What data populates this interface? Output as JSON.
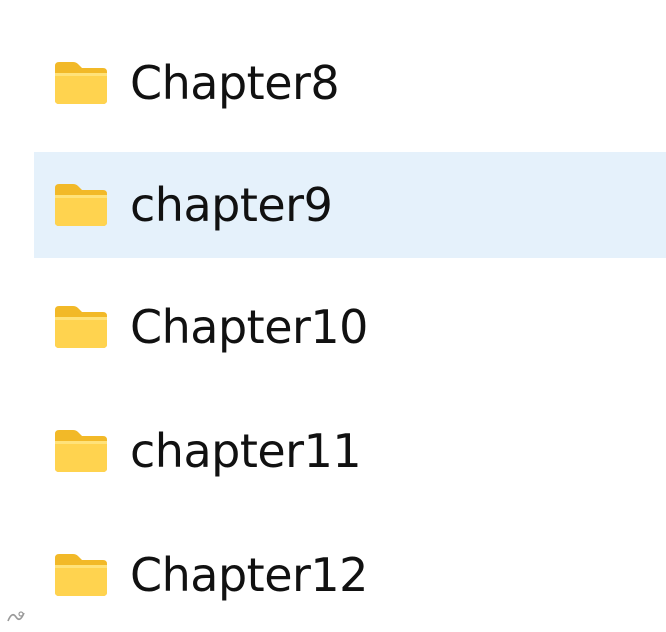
{
  "explorer": {
    "selected_index": 1,
    "selection_color": "#e5f1fb",
    "folder_icon": "folder-icon",
    "items": [
      {
        "name": "Chapter8",
        "type": "folder"
      },
      {
        "name": "chapter9",
        "type": "folder"
      },
      {
        "name": "Chapter10",
        "type": "folder"
      },
      {
        "name": "chapter11",
        "type": "folder"
      },
      {
        "name": "Chapter12",
        "type": "folder"
      }
    ]
  },
  "colors": {
    "folder_back": "#f2b928",
    "folder_front": "#ffd34f",
    "folder_highlight": "#ffe27a",
    "text": "#111111"
  }
}
